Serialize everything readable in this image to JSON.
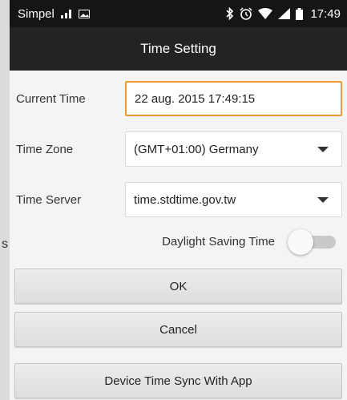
{
  "status_bar": {
    "carrier": "Simpel",
    "time": "17:49",
    "icons": [
      "signal-bars-icon",
      "image-icon",
      "bluetooth-icon",
      "alarm-icon",
      "wifi-icon",
      "cell-signal-icon",
      "battery-icon"
    ]
  },
  "app_bar": {
    "title": "Time Setting"
  },
  "form": {
    "current_time": {
      "label": "Current Time",
      "value": "22 aug. 2015 17:49:15"
    },
    "time_zone": {
      "label": "Time Zone",
      "value": "(GMT+01:00) Germany"
    },
    "time_server": {
      "label": "Time Server",
      "value": "time.stdtime.gov.tw"
    },
    "daylight_saving": {
      "label": "Daylight Saving Time",
      "enabled": false
    }
  },
  "buttons": {
    "ok": "OK",
    "cancel": "Cancel",
    "sync": "Device Time Sync With App"
  },
  "background_fragment": "s",
  "colors": {
    "focus_accent": "#f09a2e",
    "app_bar": "#232323",
    "status_bar": "#151515"
  }
}
